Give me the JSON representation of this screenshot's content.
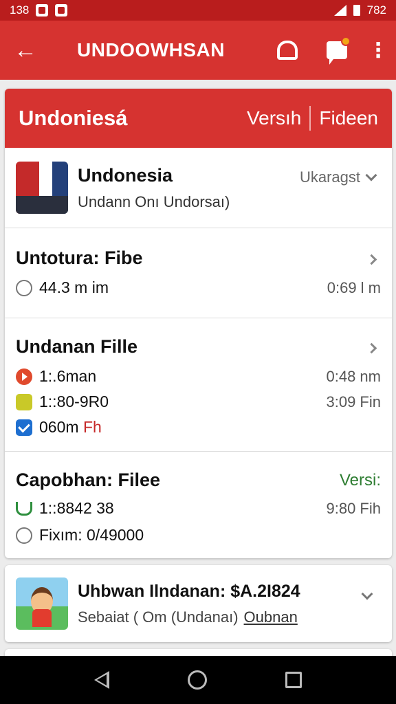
{
  "status_bar": {
    "time": "138",
    "battery": "782"
  },
  "app_bar": {
    "back_icon": "arrow-left-icon",
    "title": "UNDOOWHSAN",
    "bell_icon": "bell-icon",
    "chat_icon": "chat-icon",
    "more_icon": "more-vert-icon",
    "badge_color": "#f2a516"
  },
  "main": {
    "header": {
      "title": "Undoniesá",
      "tab1": "Versıh",
      "tab2": "Fideen"
    },
    "profile": {
      "name": "Undonesia",
      "subtitle": "Undann Onı Undorsaı)",
      "dropdown_label": "Ukaragst"
    },
    "section_a": {
      "title": "Untotura: Fibe",
      "row1_left": "44.3 m im",
      "row1_right": "0:69 l m"
    },
    "section_b": {
      "title": "Undanan Fille",
      "row1_left": "1:.6man",
      "row1_right": "0:48 nm",
      "row2_left": "1::80-9R0",
      "row2_right": "3:09 Fin",
      "row3_left": "060m",
      "row3_accent": "Fh"
    },
    "section_c": {
      "title": "Capobhan: Filee",
      "title_right": "Versi:",
      "row1_left": "1::8842 38",
      "row1_right": "9:80 Fih",
      "row2_left": "Fixım: 0/49000"
    }
  },
  "card2": {
    "title": "Uhbwan Ilndanan: $A.2I824",
    "subtitle": "Sebaiat ( Om (Undanaı)",
    "link": "Oubnan"
  },
  "colors": {
    "primary": "#d63330",
    "status_bar": "#b91d1d",
    "accent_green": "#2e7d32",
    "accent_red": "#c62828"
  }
}
